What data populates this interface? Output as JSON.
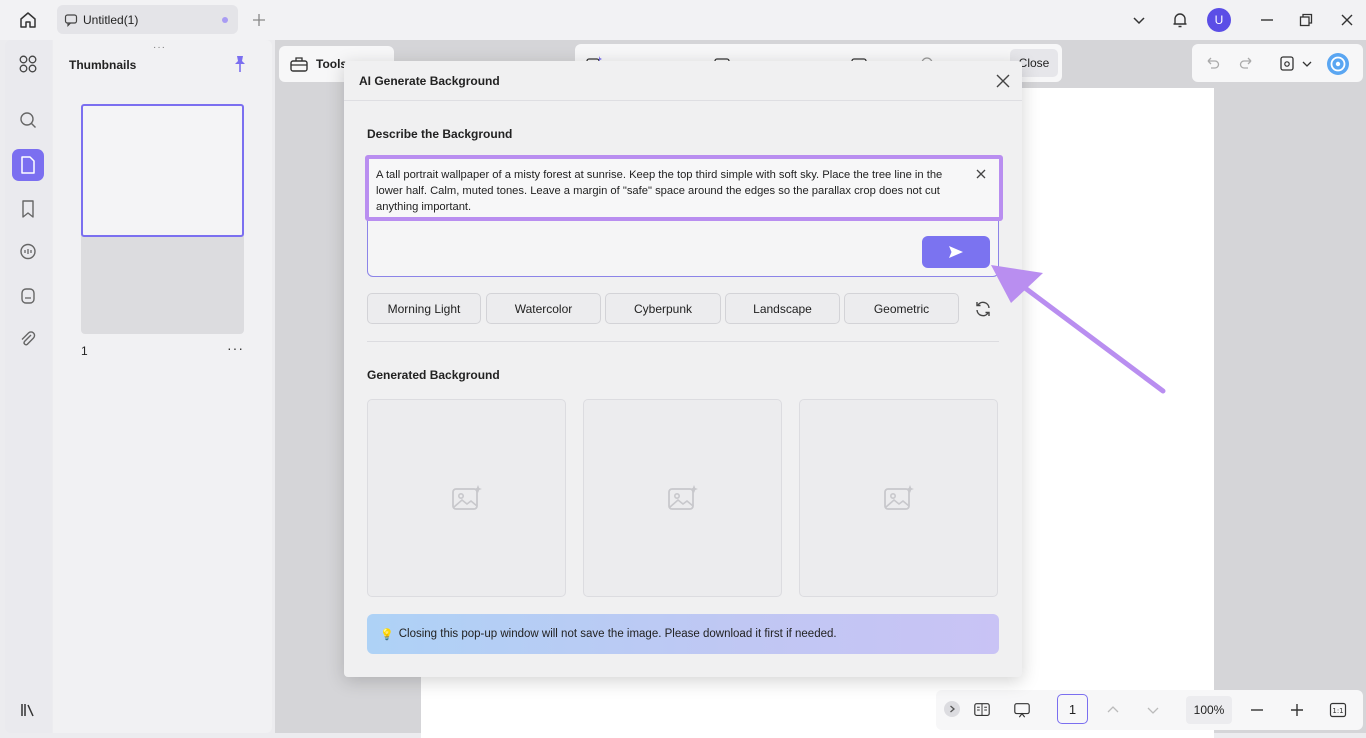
{
  "tab": {
    "title": "Untitled(1)"
  },
  "user": {
    "avatar_letter": "U"
  },
  "thumbnails": {
    "title": "Thumbnails",
    "page_number": "1",
    "more": "···",
    "drag": "···"
  },
  "toolbar": {
    "tools_label": "Tools",
    "close_label": "Close"
  },
  "bottombar": {
    "page": "1",
    "zoom": "100%"
  },
  "modal": {
    "title": "AI Generate Background",
    "describe_label": "Describe the Background",
    "prompt_text": "A tall portrait wallpaper of a misty forest at sunrise. Keep the top third simple with soft sky. Place the tree line in the lower half. Calm, muted tones. Leave a margin of \"safe\" space around the edges so the parallax crop does not cut anything important.",
    "styles": [
      "Morning Light",
      "Watercolor",
      "Cyberpunk",
      "Landscape",
      "Geometric"
    ],
    "generated_label": "Generated Background",
    "notice": "Closing this pop-up window will not save the image. Please download it first if needed."
  },
  "colors": {
    "accent": "#7b6ff0",
    "highlight": "#b98ef0",
    "send": "#7b73f0"
  },
  "icons": [
    "home-icon",
    "search-icon",
    "page-icon",
    "bookmark-icon",
    "comment-icon",
    "stamp-icon",
    "attachment-icon",
    "pin-icon",
    "bell-icon",
    "minimize-icon",
    "restore-icon",
    "close-icon",
    "send-icon",
    "refresh-icon",
    "image-sparkle-icon",
    "bulb-icon"
  ]
}
